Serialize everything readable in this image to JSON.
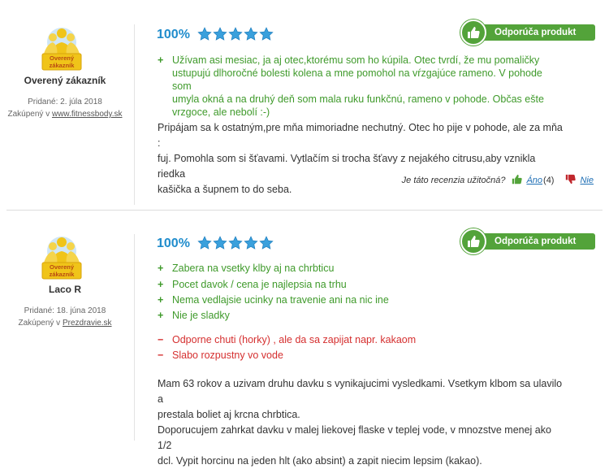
{
  "reviews": [
    {
      "badge_text": "Overený zákazník",
      "username": "Overený zákazník",
      "date": "Pridané: 2. júla 2018",
      "bought_prefix": "Zakúpený v",
      "bought_shop": "www.fitnessbody.sk",
      "percent": "100%",
      "stars": 5,
      "recommend_label": "Odporúča produkt",
      "pros": [
        "Užívam asi mesiac, ja aj otec,ktorému som ho kúpila. Otec tvrdí, že mu pomaličky\nustupujú dlhoročné bolesti kolena a mne pomohol na vŕzgajúce rameno. V pohode som\numyla okná a na druhý deň som mala ruku funkčnú, rameno v pohode. Občas ešte\nvrzgoce, ale nebolí :-)"
      ],
      "cons": [],
      "text": "Pripájam sa k ostatným,pre mňa mimoriadne nechutný. Otec ho pije v pohode, ale za mňa :\nfuj. Pomohla som si šťavami. Vytlačím si trocha šťavy z nejakého citrusu,aby vznikla riedka\nkašička a šupnem to do seba.",
      "helpful": {
        "question": "Je táto recenzia užitočná?",
        "yes_label": "Áno",
        "yes_count": "(4)",
        "no_label": "Nie"
      }
    },
    {
      "badge_text": "Overený zákazník",
      "username": "Laco R",
      "date": "Pridané: 18. júna 2018",
      "bought_prefix": "Zakúpený v",
      "bought_shop": "Prezdravie.sk",
      "percent": "100%",
      "stars": 5,
      "recommend_label": "Odporúča produkt",
      "pros": [
        "Zabera na vsetky klby aj na chrbticu",
        "Pocet davok / cena je najlepsia na trhu",
        "Nema vedlajsie ucinky na travenie ani na nic ine",
        "Nie je sladky"
      ],
      "cons": [
        "Odporne chuti (horky) , ale da sa zapijat napr. kakaom",
        "Slabo rozpustny vo vode"
      ],
      "text": "Mam 63 rokov a uzivam druhu davku s vynikajucimi vysledkami. Vsetkym klbom sa ulavilo a\nprestala boliet aj krcna chrbtica.\nDoporucujem zahrkat davku v malej liekovej flaske v teplej vode, v mnozstve menej ako 1/2\ndcl. Vypit horcinu na jeden hlt (ako absint) a zapit niecim lepsim (kakao)."
    }
  ],
  "colors": {
    "accent_blue": "#1f8ccc",
    "star_blue": "#3aa0dc",
    "recommend_green": "#53a33a",
    "pro_green": "#3f9a2b",
    "con_red": "#d52f2f"
  },
  "icons": {
    "badge": "verified-customer-badge-icon",
    "star": "star-icon",
    "thumb_up": "thumbs-up-icon",
    "thumb_down": "thumbs-down-icon"
  }
}
